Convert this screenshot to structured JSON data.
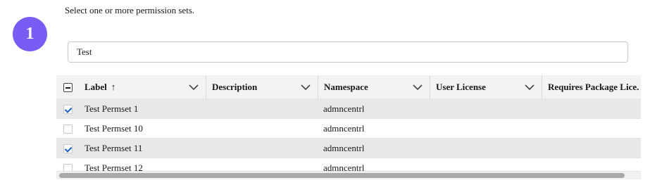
{
  "step": {
    "number": "1"
  },
  "instruction": "Select one or more permission sets.",
  "search": {
    "value": "Test"
  },
  "table": {
    "columns": [
      {
        "label": "Label",
        "sort_icon": "up-arrow",
        "chevron": true
      },
      {
        "label": "Description",
        "chevron": true
      },
      {
        "label": "Namespace",
        "chevron": true
      },
      {
        "label": "User License",
        "chevron": true
      },
      {
        "label": "Requires Package Lice.",
        "chevron": false
      }
    ],
    "header_checkbox": "indeterminate",
    "rows": [
      {
        "label": "Test Permset 1",
        "description": "",
        "namespace": "admncentrl",
        "user_license": "",
        "requires_package_license": "",
        "checked": true
      },
      {
        "label": "Test Permset 10",
        "description": "",
        "namespace": "admncentrl",
        "user_license": "",
        "requires_package_license": "",
        "checked": false
      },
      {
        "label": "Test Permset 11",
        "description": "",
        "namespace": "admncentrl",
        "user_license": "",
        "requires_package_license": "",
        "checked": true
      },
      {
        "label": "Test Permset 12",
        "description": "",
        "namespace": "admncentrl",
        "user_license": "",
        "requires_package_license": "",
        "checked": false
      }
    ]
  },
  "colors": {
    "badge": "#7a5cf5",
    "selected_row": "#e8e8e6",
    "checkmark": "#1b5fc1"
  },
  "sort_arrow": "↑"
}
